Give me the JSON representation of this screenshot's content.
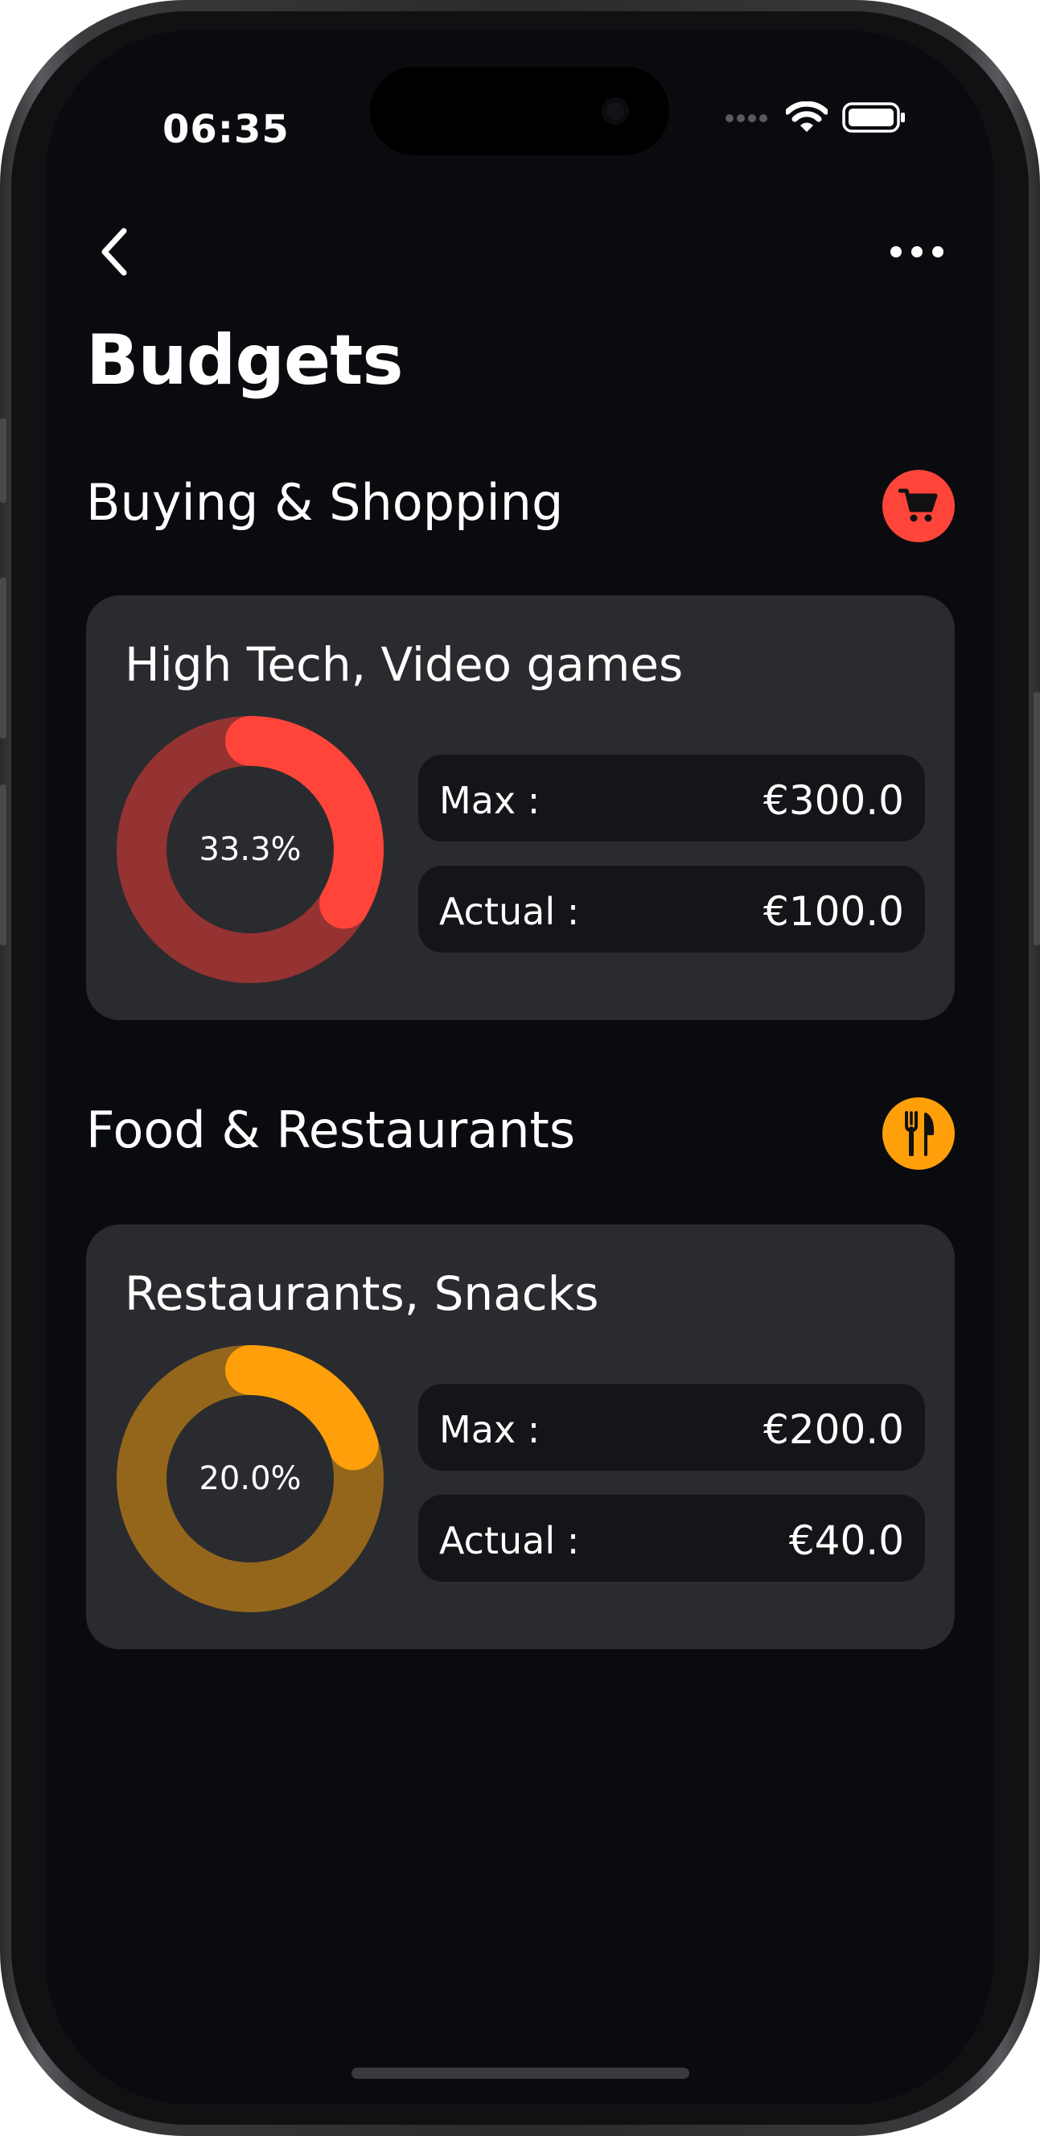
{
  "status_bar": {
    "time": "06:35"
  },
  "nav": {
    "back_icon": "chevron-left-icon",
    "more_icon": "ellipsis-icon"
  },
  "page": {
    "title": "Budgets"
  },
  "sections": [
    {
      "title": "Buying & Shopping",
      "icon": "shopping-cart-icon",
      "icon_color": "#ff453a",
      "budget": {
        "title": "High Tech, Video games",
        "percent_label": "33.3%",
        "fraction": 0.333,
        "ring_color": "#ff453a",
        "track_color": "#943331",
        "max_label": "Max :",
        "max_value": "€300.0",
        "actual_label": "Actual :",
        "actual_value": "€100.0"
      }
    },
    {
      "title": "Food & Restaurants",
      "icon": "fork-knife-icon",
      "icon_color": "#ff9f0a",
      "budget": {
        "title": "Restaurants, Snacks",
        "percent_label": "20.0%",
        "fraction": 0.2,
        "ring_color": "#ff9f0a",
        "track_color": "#94661c",
        "max_label": "Max :",
        "max_value": "€200.0",
        "actual_label": "Actual :",
        "actual_value": "€40.0"
      }
    }
  ]
}
